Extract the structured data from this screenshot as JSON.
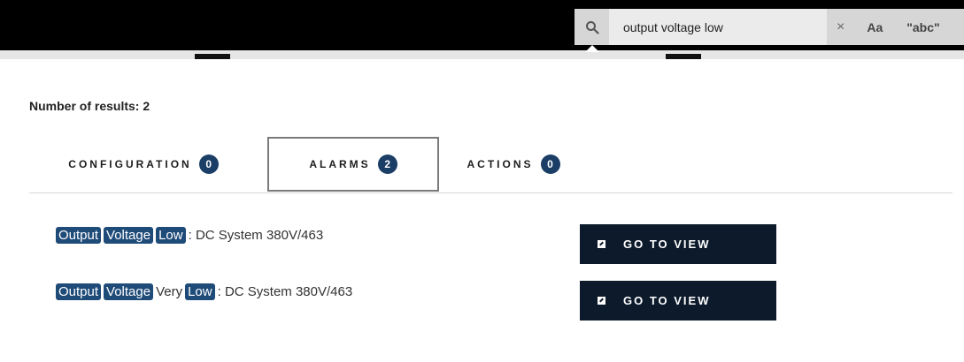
{
  "search": {
    "value": "output voltage low",
    "clear": "×",
    "case": "Aa",
    "exact": "\"abc\""
  },
  "results": {
    "count_label": "Number of results: 2"
  },
  "tabs": [
    {
      "label": "CONFIGURATION",
      "count": "0"
    },
    {
      "label": "ALARMS",
      "count": "2",
      "active": true
    },
    {
      "label": "ACTIONS",
      "count": "0"
    }
  ],
  "rows": [
    {
      "w1": "Output",
      "w2": "Voltage",
      "w3": "Low",
      "suffix": ": DC System 380V/463",
      "button": "GO TO VIEW"
    },
    {
      "w1": "Output",
      "w2": "Voltage",
      "mid": "Very",
      "w3": "Low",
      "suffix": ": DC System 380V/463",
      "button": "GO TO VIEW"
    }
  ],
  "colors": {
    "badge": "#1b3e66",
    "highlight": "#1f4b79",
    "button_bg": "#0c1a2b",
    "topbar": "#000000"
  }
}
